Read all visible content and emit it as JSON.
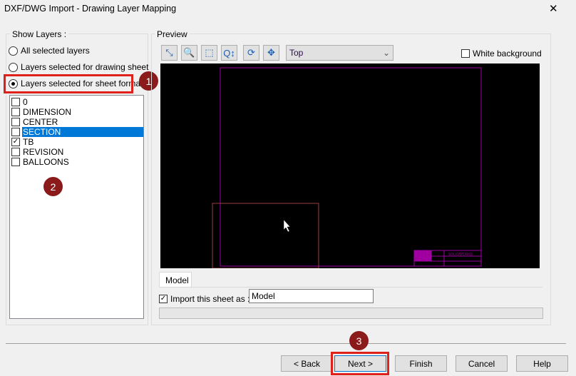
{
  "window": {
    "title": "DXF/DWG Import - Drawing Layer Mapping",
    "close": "✕"
  },
  "show_layers": {
    "label": "Show Layers :",
    "options": [
      {
        "label": "All selected layers",
        "selected": false
      },
      {
        "label": "Layers selected for drawing sheet",
        "selected": false
      },
      {
        "label": "Layers selected for sheet format",
        "selected": true
      }
    ],
    "layers": [
      {
        "name": "0",
        "checked": false,
        "highlighted": false
      },
      {
        "name": "DIMENSION",
        "checked": false,
        "highlighted": false
      },
      {
        "name": "CENTER",
        "checked": false,
        "highlighted": false
      },
      {
        "name": "SECTION",
        "checked": false,
        "highlighted": true
      },
      {
        "name": "TB",
        "checked": true,
        "highlighted": false
      },
      {
        "name": "REVISION",
        "checked": false,
        "highlighted": false
      },
      {
        "name": "BALLOONS",
        "checked": false,
        "highlighted": false
      }
    ]
  },
  "preview": {
    "label": "Preview",
    "tools": [
      "select-icon",
      "zoom-icon",
      "zoom-area-icon",
      "zoom-in-out-icon",
      "rotate-icon",
      "pan-icon"
    ],
    "view": "Top",
    "white_background_label": "White background",
    "white_background": false
  },
  "sheet": {
    "tab": "Model",
    "import_label": "Import this sheet as :",
    "import_checked": true,
    "name": "Model"
  },
  "annotations": [
    "1",
    "2",
    "3"
  ],
  "buttons": {
    "back": "< Back",
    "next": "Next >",
    "finish": "Finish",
    "cancel": "Cancel",
    "help": "Help"
  },
  "colors": {
    "highlight": "#0078d7",
    "annotation": "#8b1a1a",
    "callout_box": "#e0201b",
    "sheet_border": "#a000a0"
  }
}
